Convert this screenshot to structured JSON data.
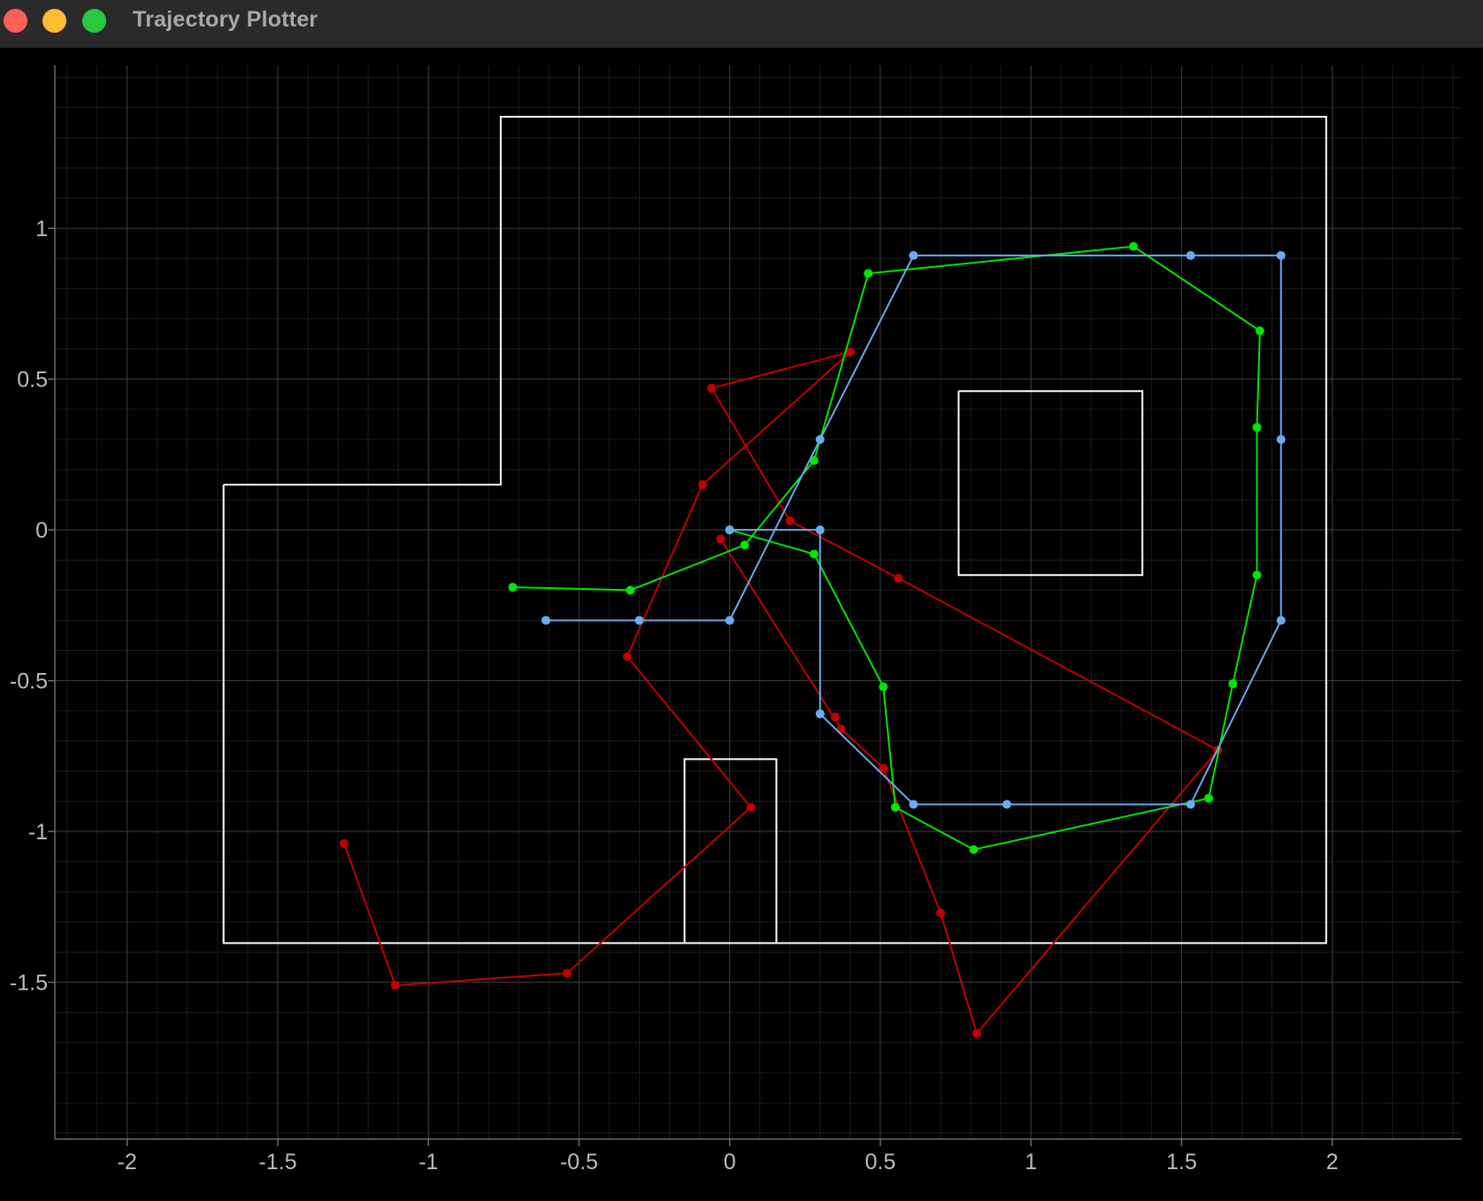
{
  "window": {
    "title": "Trajectory Plotter"
  },
  "colors": {
    "background": "#000000",
    "titlebar": "#2a2a2a",
    "grid_major": "#3c3c3c",
    "grid_minor": "#1c1c1c",
    "boundary": "#ffffff",
    "series_red": "#c00000",
    "series_green": "#00e600",
    "series_blue": "#6aaaf0"
  },
  "chart_data": {
    "type": "line",
    "title": "",
    "xlabel": "",
    "ylabel": "",
    "xlim": [
      -2.24,
      2.43
    ],
    "ylim": [
      -2.02,
      1.54
    ],
    "grid": true,
    "x_ticks": [
      -2,
      -1.5,
      -1,
      -0.5,
      0,
      0.5,
      1,
      1.5,
      2
    ],
    "x_tick_labels": [
      "-2",
      "-1.5",
      "-1",
      "-0.5",
      "0",
      "0.5",
      "1",
      "1.5",
      "2"
    ],
    "y_ticks": [
      1,
      0.5,
      0,
      -0.5,
      -1,
      -1.5
    ],
    "y_tick_labels": [
      "1",
      "0.5",
      "0",
      "-0.5",
      "-1",
      "-1.5"
    ],
    "obstacles": [
      [
        [
          -1.68,
          0.15
        ],
        [
          -0.76,
          0.15
        ],
        [
          -0.76,
          1.37
        ],
        [
          1.98,
          1.37
        ],
        [
          1.98,
          -1.37
        ],
        [
          -1.68,
          -1.37
        ],
        [
          -1.68,
          0.15
        ]
      ],
      [
        [
          0.76,
          0.46
        ],
        [
          1.37,
          0.46
        ],
        [
          1.37,
          -0.15
        ],
        [
          0.76,
          -0.15
        ],
        [
          0.76,
          0.46
        ]
      ],
      [
        [
          -0.15,
          -1.37
        ],
        [
          -0.15,
          -0.76
        ],
        [
          0.155,
          -0.76
        ],
        [
          0.155,
          -1.37
        ]
      ]
    ],
    "series": [
      {
        "color": "#c00000",
        "x": [
          0.4,
          -0.09,
          -0.34,
          0.07,
          -0.54,
          -1.11,
          -1.28
        ],
        "y": [
          0.59,
          0.15,
          -0.42,
          -0.92,
          -1.47,
          -1.51,
          -1.04
        ]
      },
      {
        "color": "#c00000",
        "x": [
          -0.06,
          0.2,
          0.56,
          1.62,
          0.82,
          0.7,
          0.51,
          0.37,
          -0.03
        ],
        "y": [
          0.47,
          0.03,
          -0.16,
          -0.73,
          -1.67,
          -1.27,
          -0.79,
          -0.66,
          -0.03
        ]
      },
      {
        "color": "#c00000",
        "x": [
          0.4,
          -0.06
        ],
        "y": [
          0.59,
          0.47
        ]
      },
      {
        "color": "#c00000",
        "x": [
          0.35
        ],
        "y": [
          -0.62
        ]
      },
      {
        "color": "#00e600",
        "x": [
          -0.72,
          -0.33,
          0.05,
          0.28,
          0.46,
          1.34,
          1.76,
          1.75,
          1.75,
          1.67,
          1.59,
          0.81,
          0.55,
          0.51,
          0.28,
          0.0
        ],
        "y": [
          -0.19,
          -0.2,
          -0.05,
          0.23,
          0.85,
          0.94,
          0.66,
          0.34,
          -0.15,
          -0.51,
          -0.89,
          -1.06,
          -0.92,
          -0.52,
          -0.08,
          0.0
        ]
      },
      {
        "color": "#6aaaf0",
        "x": [
          -0.61,
          -0.3,
          0.0,
          0.3,
          0.61,
          1.53,
          1.83,
          1.83,
          1.83,
          1.53,
          0.92,
          0.61,
          0.3,
          0.3,
          0.0
        ],
        "y": [
          -0.3,
          -0.3,
          -0.3,
          0.3,
          0.91,
          0.91,
          0.91,
          0.3,
          -0.3,
          -0.91,
          -0.91,
          -0.91,
          -0.61,
          0.0,
          0.0
        ]
      }
    ]
  }
}
